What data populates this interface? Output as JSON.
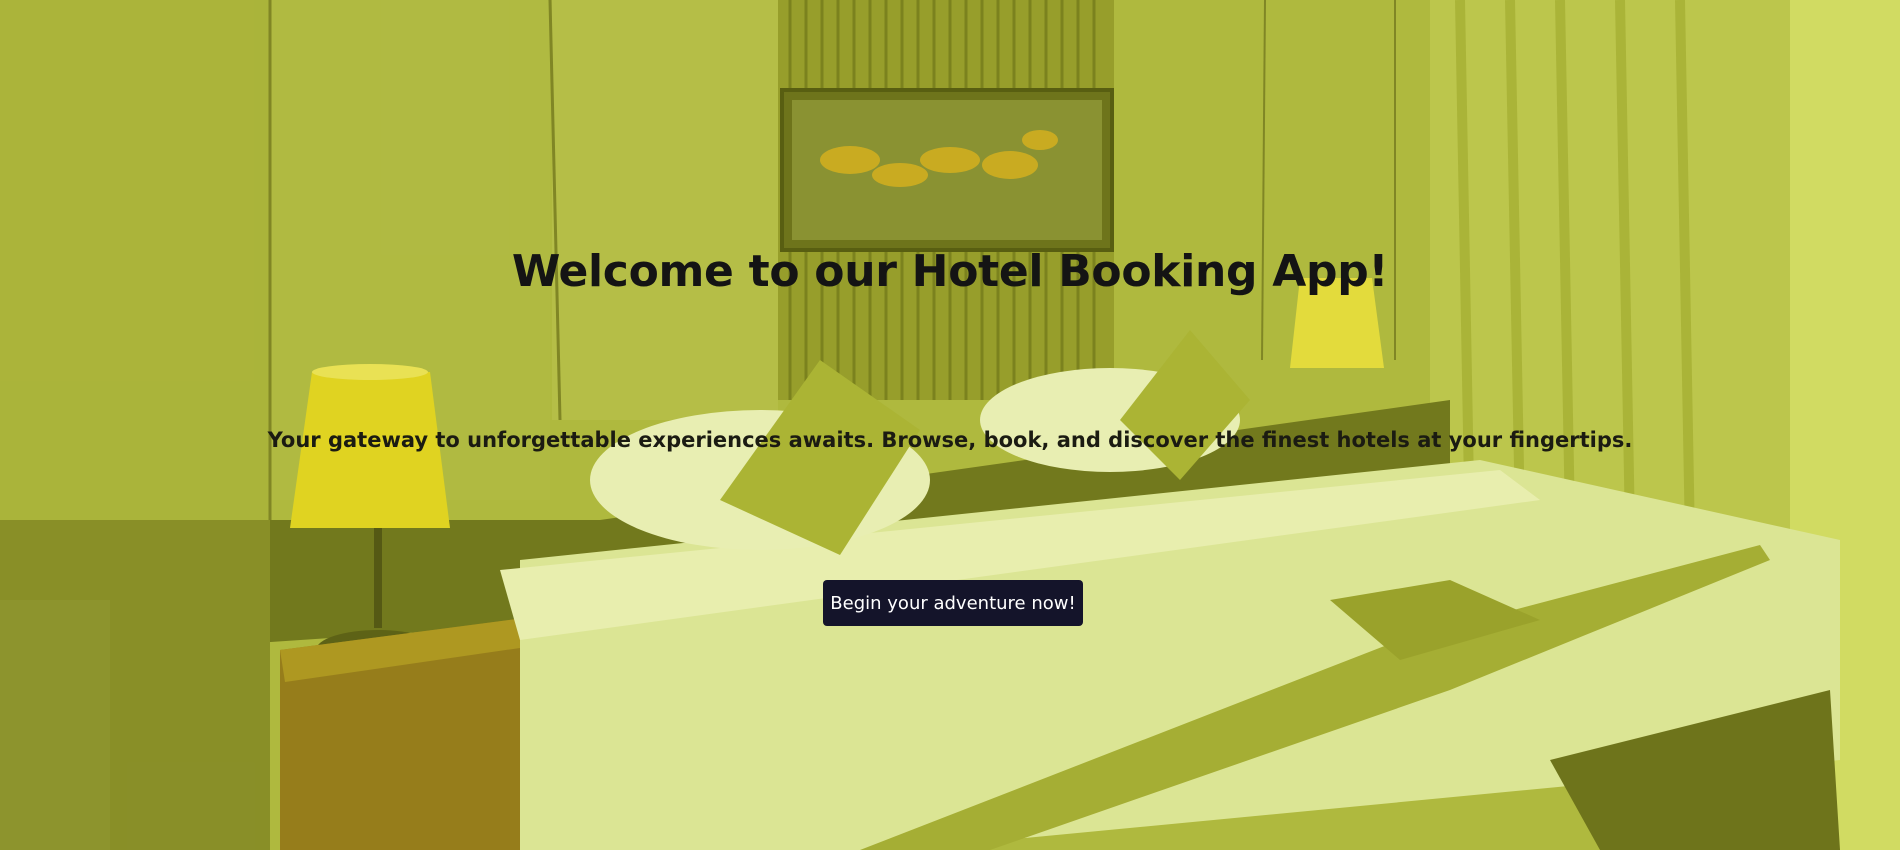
{
  "hero": {
    "title": "Welcome to our Hotel Booking App!",
    "subtitle": "Your gateway to unforgettable experiences awaits. Browse, book, and discover the finest hotels at your fingertips.",
    "cta_label": "Begin your adventure now!",
    "background_image": "hotel-bedroom-photo",
    "overlay_color": "#c8d23c"
  },
  "colors": {
    "title": "#141414",
    "button_bg": "#14142a",
    "button_text": "#ffffff"
  }
}
